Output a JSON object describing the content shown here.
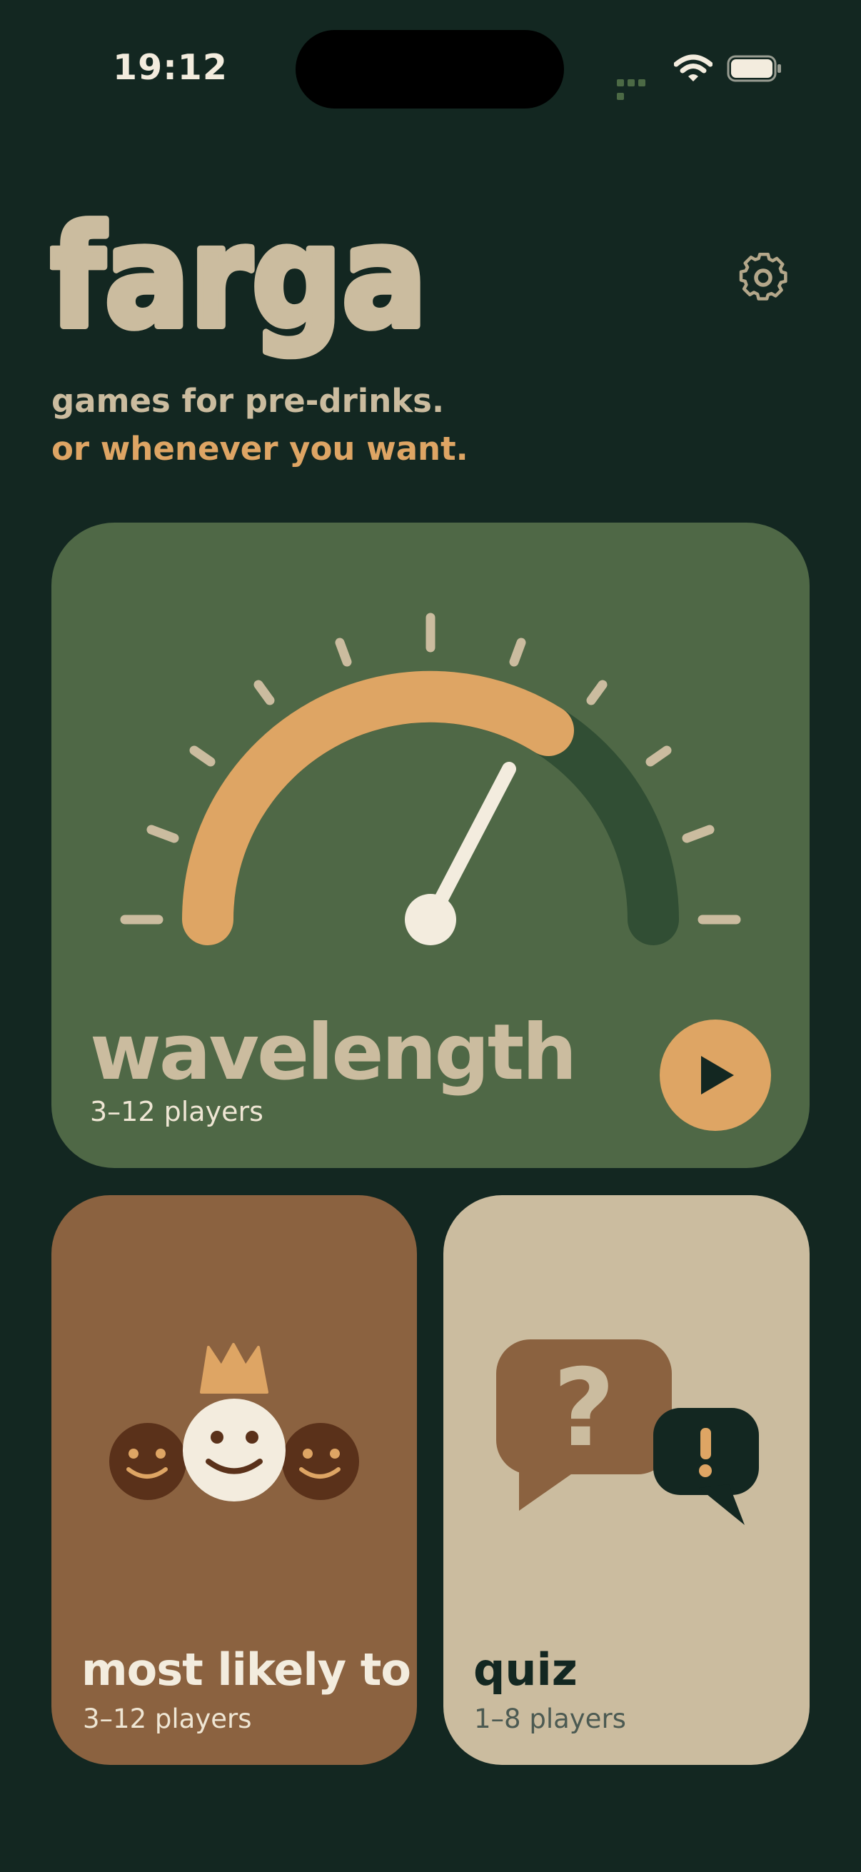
{
  "status_bar": {
    "time": "19:12",
    "icons": [
      "cellular-signal-icon",
      "wifi-icon",
      "battery-icon"
    ]
  },
  "header": {
    "logo_text": "farga",
    "tagline_line1": "games for pre-drinks.",
    "tagline_line2": "or whenever you want.",
    "settings_icon": "gear-icon"
  },
  "games": [
    {
      "title": "wavelength",
      "players": "3–12 players",
      "icon": "gauge-dial-icon",
      "action_icon": "play-icon"
    },
    {
      "title": "most likely to",
      "players": "3–12 players",
      "icon": "crowned-smiley-faces-icon"
    },
    {
      "title": "quiz",
      "players": "1–8 players",
      "icon": "question-exclamation-speech-bubbles-icon"
    }
  ],
  "colors": {
    "background": "#132721",
    "beige": "#cbbc9f",
    "orange": "#dea564",
    "green_card": "#4f6846",
    "brown_card": "#8b6240",
    "cream": "#f3ecde"
  }
}
